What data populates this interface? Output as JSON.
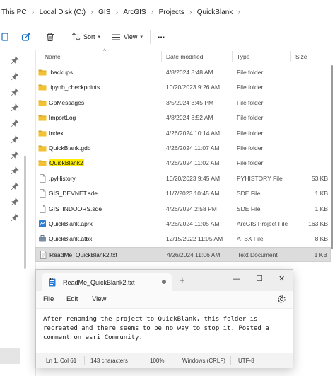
{
  "breadcrumb": [
    "This PC",
    "Local Disk (C:)",
    "GIS",
    "ArcGIS",
    "Projects",
    "QuickBlank"
  ],
  "toolbar": {
    "sort_label": "Sort",
    "view_label": "View",
    "more_label": "···"
  },
  "columns": {
    "name": "Name",
    "date": "Date modified",
    "type": "Type",
    "size": "Size"
  },
  "files": [
    {
      "name": ".backups",
      "date": "4/8/2024 8:48 AM",
      "type": "File folder",
      "size": "",
      "icon": "folder-icon"
    },
    {
      "name": ".ipynb_checkpoints",
      "date": "10/20/2023 9:26 AM",
      "type": "File folder",
      "size": "",
      "icon": "folder-icon"
    },
    {
      "name": "GpMessages",
      "date": "3/5/2024 3:45 PM",
      "type": "File folder",
      "size": "",
      "icon": "folder-icon"
    },
    {
      "name": "ImportLog",
      "date": "4/8/2024 8:52 AM",
      "type": "File folder",
      "size": "",
      "icon": "folder-icon"
    },
    {
      "name": "Index",
      "date": "4/26/2024 10:14 AM",
      "type": "File folder",
      "size": "",
      "icon": "folder-icon"
    },
    {
      "name": "QuickBlank.gdb",
      "date": "4/26/2024 11:07 AM",
      "type": "File folder",
      "size": "",
      "icon": "folder-icon"
    },
    {
      "name": "QuickBlank2",
      "date": "4/26/2024 11:02 AM",
      "type": "File folder",
      "size": "",
      "icon": "folder-icon",
      "highlight": "#ffee00"
    },
    {
      "name": ".pyHistory",
      "date": "10/20/2023 9:45 AM",
      "type": "PYHISTORY File",
      "size": "53 KB",
      "icon": "file-icon"
    },
    {
      "name": "GIS_DEVNET.sde",
      "date": "11/7/2023 10:45 AM",
      "type": "SDE File",
      "size": "1 KB",
      "icon": "file-icon"
    },
    {
      "name": "GIS_INDOORS.sde",
      "date": "4/26/2024 2:58 PM",
      "type": "SDE File",
      "size": "1 KB",
      "icon": "file-icon"
    },
    {
      "name": "QuickBlank.aprx",
      "date": "4/26/2024 11:05 AM",
      "type": "ArcGIS Project File",
      "size": "163 KB",
      "icon": "arcgis-project-icon"
    },
    {
      "name": "QuickBlank.atbx",
      "date": "12/15/2022 11:05 AM",
      "type": "ATBX File",
      "size": "8 KB",
      "icon": "toolbox-icon"
    },
    {
      "name": "ReadMe_QuickBlank2.txt",
      "date": "4/26/2024 11:06 AM",
      "type": "Text Document",
      "size": "1 KB",
      "icon": "text-file-icon",
      "selected": true
    }
  ],
  "notepad": {
    "tab_title": "ReadMe_QuickBlank2.txt",
    "menu": [
      "File",
      "Edit",
      "View"
    ],
    "content": "After renaming the project to QuickBlank, this folder is\nrecreated and there seems to be no way to stop it. Posted a\ncomment on esri Community.",
    "status": {
      "position": "Ln 1, Col 61",
      "chars": "143 characters",
      "zoom": "100%",
      "line_ending": "Windows (CRLF)",
      "encoding": "UTF-8"
    }
  },
  "colors": {
    "folder": "#f2c233",
    "folder_dark": "#d9a51f",
    "accent": "#1a6fc4",
    "highlight": "#ffee00",
    "selected_row": "#dcdcdc"
  }
}
